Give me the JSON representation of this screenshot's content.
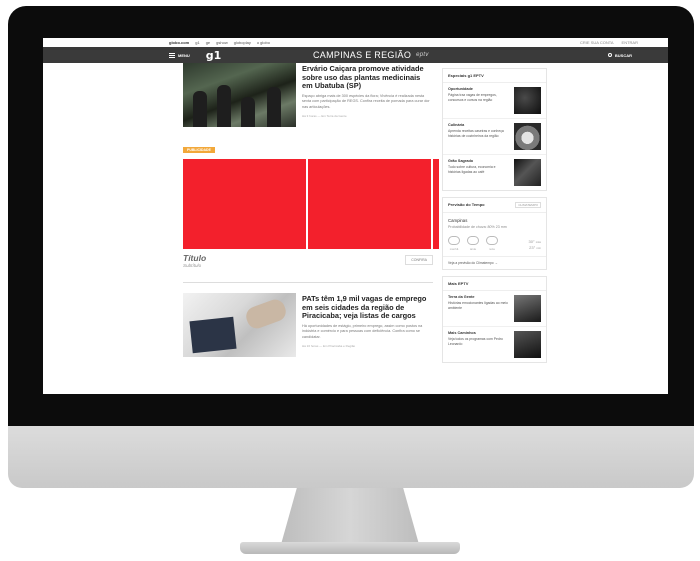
{
  "topbar": {
    "links": [
      "globo.com",
      "g1",
      "ge",
      "gshow",
      "globoplay",
      "o globo"
    ],
    "right": [
      "CRIE SUA CONTA",
      "ENTRAR"
    ]
  },
  "header": {
    "menu_label": "MENU",
    "brand": "g1",
    "region": "CAMPINAS E REGIÃO",
    "region_logo": "eptv",
    "search_label": "BUSCAR"
  },
  "feed": {
    "story1": {
      "headline": "Ervário Caiçara promove atividade sobre uso das plantas medicinais em Ubatuba (SP)",
      "summary": "Espaço abriga mais de 300 espécies da flora; Vivência é realizada nesta sexta com participação de REGS. Confira receita de pomada para curar dor nas articulações.",
      "meta": "Há 3 horas — Em Terra da Gente"
    },
    "ad": {
      "label": "PUBLICIDADE",
      "title": "Título",
      "subtitle": "Subtítulo",
      "cta": "CONFIRA"
    },
    "story2": {
      "headline": "PATs têm 1,9 mil vagas de emprego em seis cidades da região de Piracicaba; veja listas de cargos",
      "summary": "Há oportunidades de estágio, primeiro emprego, assim como postos na indústria e comércio e para pessoas com deficiência. Confira como se candidatar.",
      "meta": "Há 16 horas — Em Piracicaba e Região"
    }
  },
  "sidebar": {
    "especiais": {
      "title": "Especiais g1 EPTV",
      "items": [
        {
          "title": "Oportunidade",
          "desc": "Página traz vagas de empregos, concursos e cursos na região"
        },
        {
          "title": "Culinária",
          "desc": "Aprenda receitas caseiras e conheça histórias de cozinheiros da região"
        },
        {
          "title": "Grão Sagrado",
          "desc": "Tudo sobre cultura, economia e histórias ligadas ao café"
        }
      ]
    },
    "weather": {
      "title": "Previsão do Tempo",
      "tag": "CLIMATEMPO",
      "city": "Campinas",
      "probability": "Probabilidade de chuva: 80% 23 mm",
      "icons": [
        "manhã",
        "tarde",
        "noite"
      ],
      "max": "30°",
      "min": "23°",
      "max_label": "máx",
      "min_label": "mín",
      "link": "Veja a previsão do Climatempo"
    },
    "more": {
      "title": "Mais EPTV",
      "items": [
        {
          "title": "Terra da Gente",
          "desc": "Histórias emocionantes ligadas ao meio ambiente"
        },
        {
          "title": "Mais Caminhos",
          "desc": "Veja todos os programas com Pedro Leonardo"
        }
      ]
    }
  }
}
